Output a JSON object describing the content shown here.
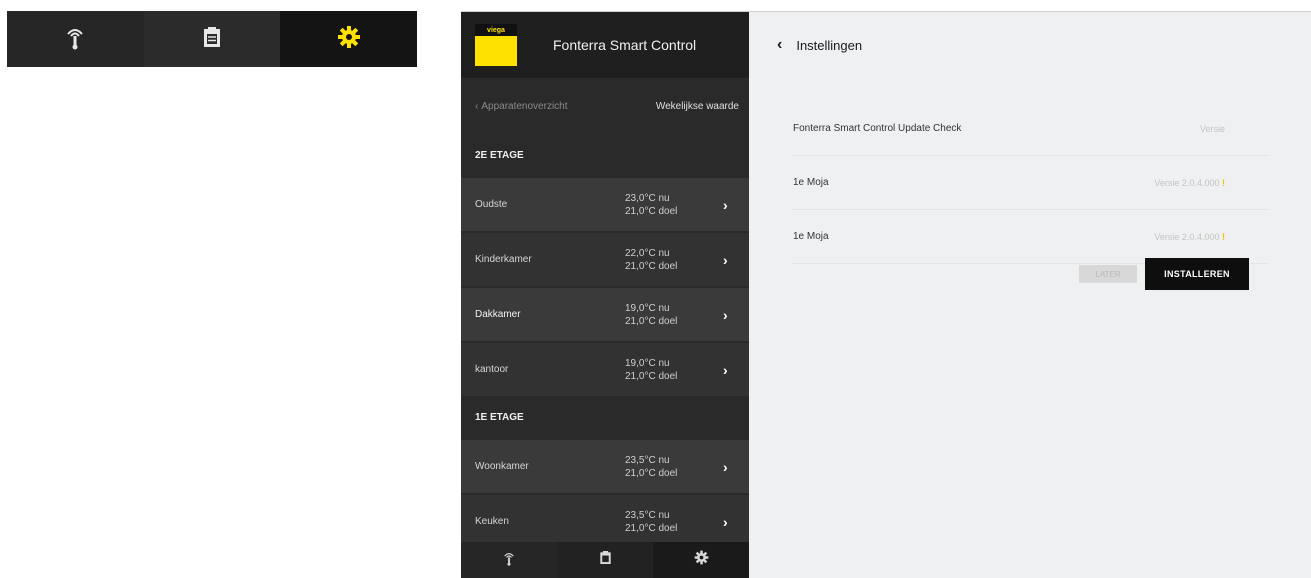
{
  "colors": {
    "accent_yellow": "#ffe100",
    "dark_panel": "#2a2a2a",
    "light_panel": "#eef0f1",
    "warning": "#f2c200"
  },
  "big_tabbar": {
    "tabs": [
      {
        "icon": "thermometer-icon"
      },
      {
        "icon": "clipboard-icon"
      },
      {
        "icon": "gear-icon",
        "active": true
      }
    ]
  },
  "app": {
    "logo_text": "viega",
    "title": "Fonterra Smart Control",
    "nav": {
      "back_label": "Apparatenoverzicht",
      "right_label": "Wekelijkse waarde"
    },
    "floors": [
      {
        "name": "2E ETAGE",
        "rooms": [
          {
            "name": "Oudste",
            "current": "23,0°C nu",
            "target": "21,0°C doel"
          },
          {
            "name": "Kinderkamer",
            "current": "22,0°C nu",
            "target": "21,0°C doel"
          },
          {
            "name": "Dakkamer",
            "current": "19,0°C nu",
            "target": "21,0°C doel"
          },
          {
            "name": "kantoor",
            "current": "19,0°C nu",
            "target": "21,0°C doel"
          }
        ]
      },
      {
        "name": "1E ETAGE",
        "rooms": [
          {
            "name": "Woonkamer",
            "current": "23,5°C nu",
            "target": "21,0°C doel"
          },
          {
            "name": "Keuken",
            "current": "23,5°C nu",
            "target": "21,0°C doel"
          }
        ]
      }
    ],
    "bottom_tabs": [
      {
        "icon": "thermometer-icon"
      },
      {
        "icon": "clipboard-icon"
      },
      {
        "icon": "gear-icon"
      }
    ]
  },
  "settings": {
    "title": "Instellingen",
    "rows": [
      {
        "label": "Fonterra Smart Control Update Check",
        "value": "Versie"
      },
      {
        "label": "1e Moja",
        "value": "Versie 2.0.4.000",
        "warn": "!"
      },
      {
        "label": "1e Moja",
        "value": "Versie 2.0.4.000",
        "warn": "!"
      }
    ],
    "later_label": "LATER",
    "install_label": "INSTALLEREN"
  }
}
